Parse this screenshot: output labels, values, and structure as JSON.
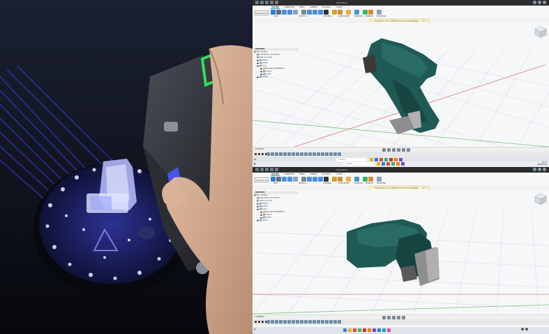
{
  "colors": {
    "scan_mesh": "#1f5a55",
    "fixture_gray": "#8e8e8e",
    "laser_blue": "#3a3cff",
    "scanner_green": "#2fe05a",
    "accent": "#0696d7"
  },
  "fusion_top": {
    "title": "ScansGray",
    "workspace": "PROGETTO",
    "tabs": [
      "SOLIDO",
      "SUPERFICIE",
      "MESH",
      "LAMIERA",
      "PLASTICA",
      "UTILITÀ"
    ],
    "groups": [
      "CREA",
      "MODIFICA",
      "ASSEMBLA",
      "COSTRUZIONE",
      "ISPEZIONA",
      "INSERISCI",
      "SELEZIONA"
    ],
    "notice": "Operazioni non modificate prima del salvataggio",
    "notice_link": "Salva",
    "browser_title": "BROWSER",
    "browser_rows": [
      "(Non salvato)",
      "Impostazioni documento",
      "Viste con nome",
      "Origine",
      "Analisi",
      "Corpi",
      "PerScapolo3d360Pezzo",
      "Corpo1",
      "Schizzi",
      "Schizzi"
    ],
    "comments": "COMMENTI"
  },
  "fusion_bottom": {
    "title": "ScansGray",
    "workspace": "PROGETTO",
    "tabs": [
      "SOLIDO",
      "SUPERFICIE",
      "MESH",
      "LAMIERA",
      "PLASTICA",
      "UTILITÀ"
    ],
    "groups": [
      "CREA",
      "MODIFICA",
      "ASSEMBLA",
      "COSTRUZIONE",
      "ISPEZIONA",
      "INSERISCI",
      "SELEZIONA"
    ],
    "notice": "Operazioni non modificate prima del salvataggio",
    "notice_link": "Salva",
    "browser_title": "BROWSER",
    "browser_rows": [
      "(Non salvato)",
      "Impostazioni documento",
      "Viste con nome",
      "Origine",
      "Analisi",
      "Corpi",
      "PerScapolo3d360Pezzo",
      "Corpo1",
      "Schizzi",
      "Schizzi"
    ],
    "comments": "COMMENTI"
  },
  "taskbar": {
    "search_placeholder": "Cerca",
    "time": "15:19",
    "date": "26/09/2024"
  },
  "icons": [
    "scanner-icon",
    "turntable-icon",
    "gun-grip-mesh-icon",
    "viewcube-icon",
    "eye-icon",
    "folder-icon",
    "windows-start-icon",
    "search-icon"
  ]
}
